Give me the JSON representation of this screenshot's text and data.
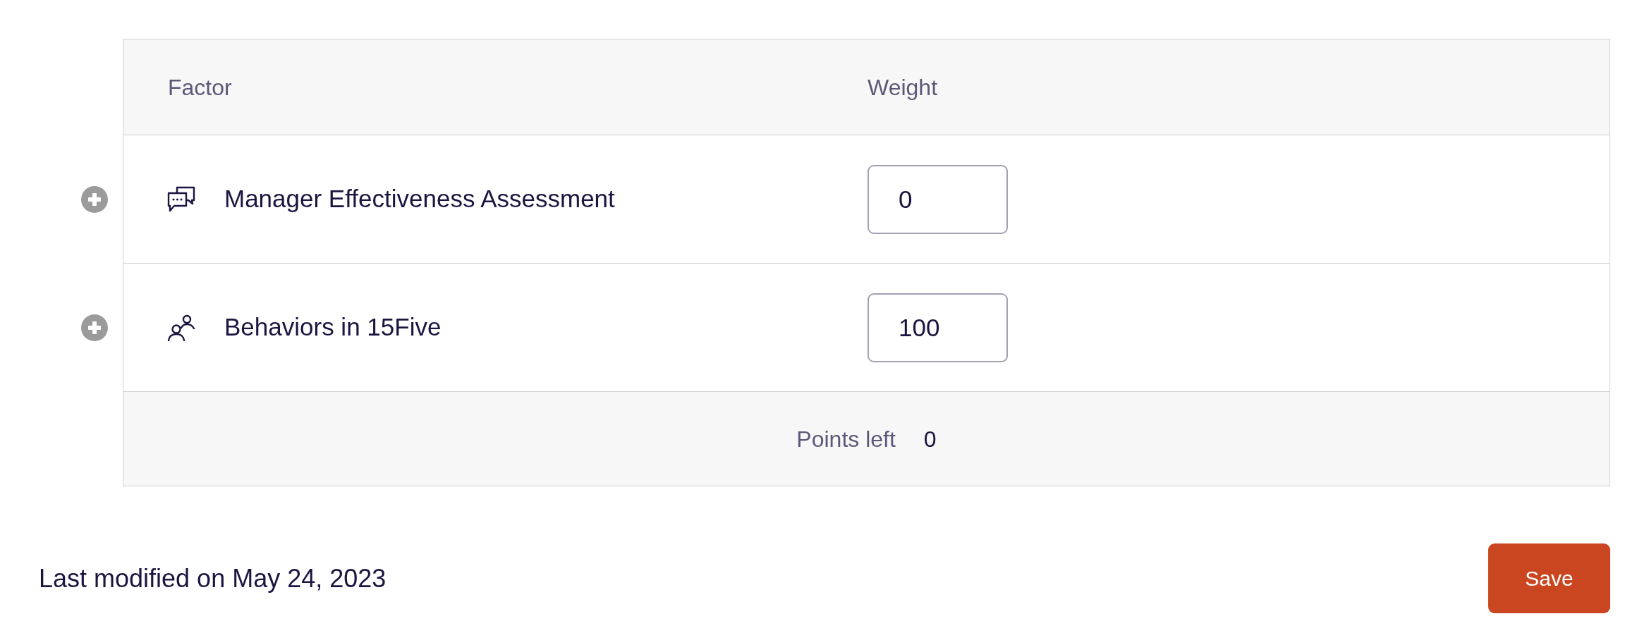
{
  "table": {
    "columns": [
      "Factor",
      "Weight"
    ],
    "rows": [
      {
        "kind": "chat",
        "factor": "Manager Effectiveness Assessment",
        "weight": "0"
      },
      {
        "kind": "people",
        "factor": "Behaviors in 15Five",
        "weight": "100"
      }
    ],
    "footer": {
      "label": "Points left",
      "value": "0"
    }
  },
  "last_modified": "Last modified on May 24, 2023",
  "save_button": "Save"
}
